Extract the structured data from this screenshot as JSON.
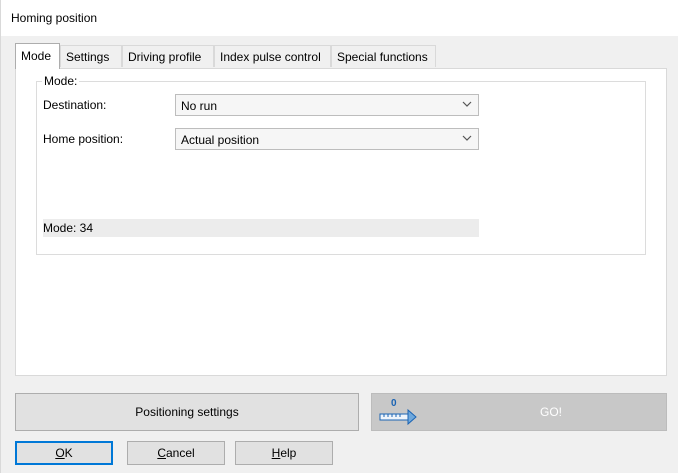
{
  "window": {
    "title": "Homing position"
  },
  "tabs": [
    {
      "label": "Mode",
      "active": true
    },
    {
      "label": "Settings",
      "active": false
    },
    {
      "label": "Driving profile",
      "active": false
    },
    {
      "label": "Index pulse control",
      "active": false
    },
    {
      "label": "Special functions",
      "active": false
    }
  ],
  "mode_group": {
    "label": "Mode:",
    "destination": {
      "label": "Destination:",
      "value": "No run"
    },
    "home_position": {
      "label": "Home position:",
      "value": "Actual position"
    },
    "mode_readout": "Mode: 34"
  },
  "commands": {
    "positioning_settings": "Positioning settings",
    "go_label": "GO!",
    "go_zero": "0"
  },
  "buttons": {
    "ok": {
      "accel": "O",
      "rest": "K"
    },
    "cancel": {
      "accel": "C",
      "rest": "ancel"
    },
    "help": {
      "accel": "H",
      "rest": "elp"
    }
  },
  "colors": {
    "focus": "#0078d7",
    "ruler": "#1a63b3"
  },
  "icons": {
    "combo_arrow": "chevron-down-icon",
    "go_icon": "ruler-arrow-icon"
  }
}
